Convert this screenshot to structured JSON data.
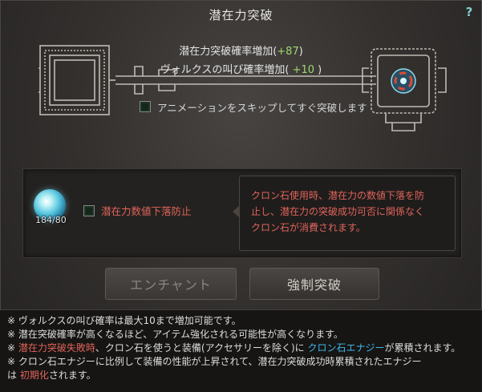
{
  "window": {
    "title": "潜在力突破",
    "help_label": "?"
  },
  "rates": {
    "breakthrough_label": "潜在力突破確率増加(",
    "breakthrough_value": "+87",
    "breakthrough_close": ")",
    "volcus_label": "ヴォルクスの叫び確率増加( ",
    "volcus_value": "+10",
    "volcus_close": " )"
  },
  "skip_animation": {
    "label": "アニメーションをスキップしてすぐ突破します",
    "checked": false
  },
  "material": {
    "icon": "cron-stone-icon",
    "count": "184/80",
    "prevent_label": "潜在力数値下落防止",
    "checked": false,
    "tooltip_lines": [
      "クロン石使用時、潜在力の数値下落を防",
      "止し、潜在力の突破成功可否に関係なく",
      "クロン石が消費されます。"
    ]
  },
  "buttons": {
    "enchant": "エンチャント",
    "force": "強制突破"
  },
  "notes": {
    "line1": "※ ヴォルクスの叫び確率は最大10まで増加可能です。",
    "line2": "※ 潜在突破確率が高くなるほど、アイテム強化される可能性が高くなります。",
    "line3_prefix": "※ ",
    "line3_red": "潜在力突破失敗時",
    "line3_mid": "、クロン石を使うと装備(アクセサリーを除く)に ",
    "line3_cyan": "クロン石エナジー",
    "line3_suffix": "が累積されます。",
    "line4": "※ クロン石エナジーに比例して装備の性能が上昇されて、潜在力突破成功時累積されたエナジー",
    "line5_prefix": "は ",
    "line5_red": "初期化",
    "line5_suffix": "されます。"
  },
  "colors": {
    "positive": "#9fd96b",
    "warning": "#e0645a",
    "energy": "#3fb6e8"
  }
}
